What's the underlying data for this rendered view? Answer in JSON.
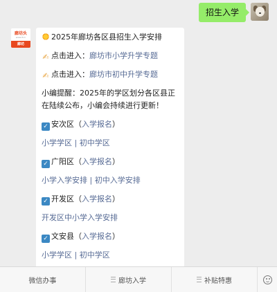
{
  "user_message": {
    "text": "招生入学"
  },
  "bot": {
    "logo": {
      "text": "廊坊头",
      "sub": "www.lf.cn",
      "bottom": "廊坊"
    }
  },
  "message": {
    "title": "2025年廊坊各区县招生入学安排",
    "line1_prefix": "点击进入：",
    "line1_link": "廊坊市小学升学专题",
    "line2_prefix": "点击进入：",
    "line2_link": "廊坊市初中升学专题",
    "notice": "小编提醒：2025年的学区划分各区县正在陆续公布，小编会持续进行更新！",
    "districts": [
      {
        "name": "安次区",
        "paren_open": "（",
        "enroll_link": "入学报名",
        "paren_close": "）",
        "link_a": "小学学区",
        "sep": " | ",
        "link_b": "初中学区"
      },
      {
        "name": "广阳区",
        "paren_open": "（",
        "enroll_link": "入学报名",
        "paren_close": "）",
        "link_a": "小学入学安排",
        "sep": " | ",
        "link_b": "初中入学安排"
      },
      {
        "name": "开发区",
        "paren_open": "（",
        "enroll_link": "入学报名",
        "paren_close": "）",
        "link_a": "开发区中小学入学安排"
      },
      {
        "name": "文安县",
        "paren_open": "（",
        "enroll_link": "入学报名",
        "paren_close": "）",
        "link_a": "小学学区",
        "sep": " | ",
        "link_b": "初中学区"
      }
    ]
  },
  "bottom_menu": {
    "items": [
      "微信办事",
      "廊坊入学",
      "补贴特惠"
    ]
  },
  "icons": {
    "sun": "sun-emoji-icon",
    "hand": "writing-hand-icon",
    "check": "check-box-icon",
    "menu": "menu-lines-icon",
    "keyboard": "emoji-face-icon"
  },
  "colors": {
    "link": "#576b95",
    "user_bubble": "#95ec69",
    "check": "#3b88c3"
  }
}
